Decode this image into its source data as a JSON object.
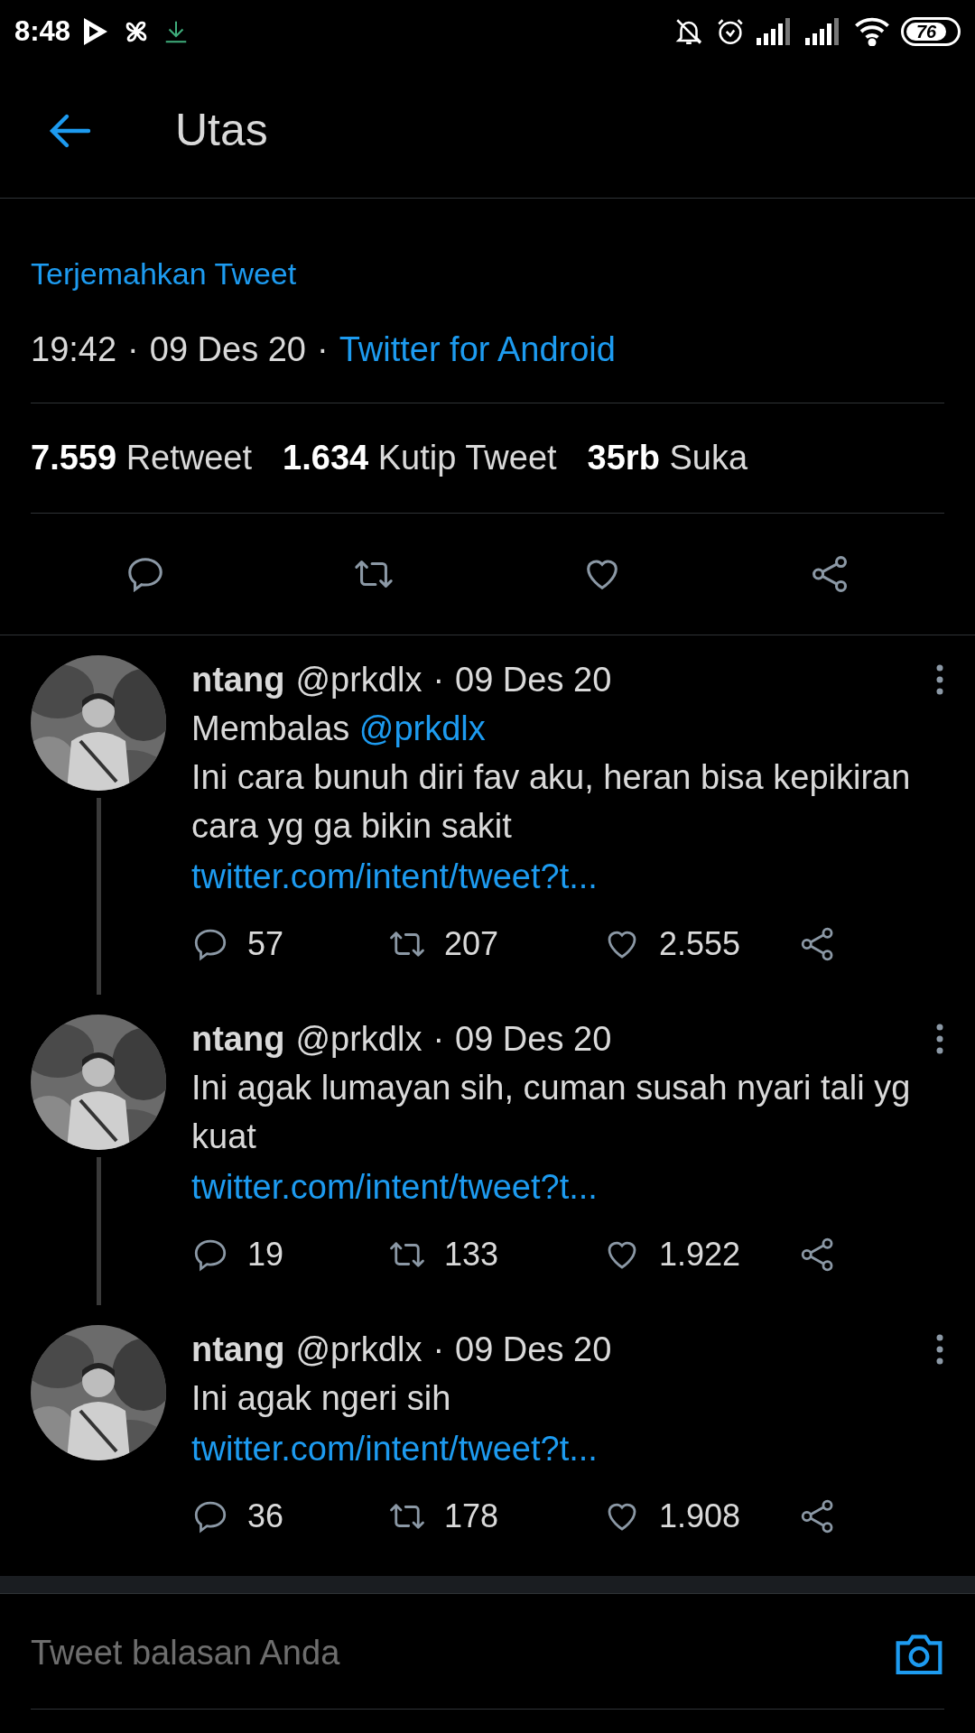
{
  "status_bar": {
    "time": "8:48",
    "battery": "76"
  },
  "header": {
    "title": "Utas"
  },
  "main_tweet": {
    "translate": "Terjemahkan Tweet",
    "time": "19:42",
    "date": "09 Des 20",
    "source": "Twitter for Android",
    "separators": [
      "·",
      "·"
    ],
    "stats": [
      "**7.559** Retweet",
      "**1.634** Kutip Tweet",
      "**35rb** Suka"
    ]
  },
  "replies": [
    {
      "name": "ntang",
      "handle": "@prkdlx",
      "separator": "·",
      "date": "09 Des 20",
      "replying_to": {
        "label": "Membalas",
        "handle": "@prkdlx"
      },
      "text": "Ini cara bunuh diri fav aku, heran bisa kepikiran cara yg ga bikin sakit",
      "link": "twitter.com/intent/tweet?t...",
      "replies": "57",
      "retweets": "207",
      "likes": "2.555",
      "thread_line": true
    },
    {
      "name": "ntang",
      "handle": "@prkdlx",
      "separator": "·",
      "date": "09 Des 20",
      "text": "Ini agak lumayan sih, cuman susah nyari tali yg kuat",
      "link": "twitter.com/intent/tweet?t...",
      "replies": "19",
      "retweets": "133",
      "likes": "1.922",
      "thread_line": true
    },
    {
      "name": "ntang",
      "handle": "@prkdlx",
      "separator": "·",
      "date": "09 Des 20",
      "text": "Ini agak ngeri sih",
      "link": "twitter.com/intent/tweet?t...",
      "replies": "36",
      "retweets": "178",
      "likes": "1.908",
      "thread_line": false
    }
  ],
  "composer": {
    "placeholder": "Tweet balasan Anda"
  }
}
